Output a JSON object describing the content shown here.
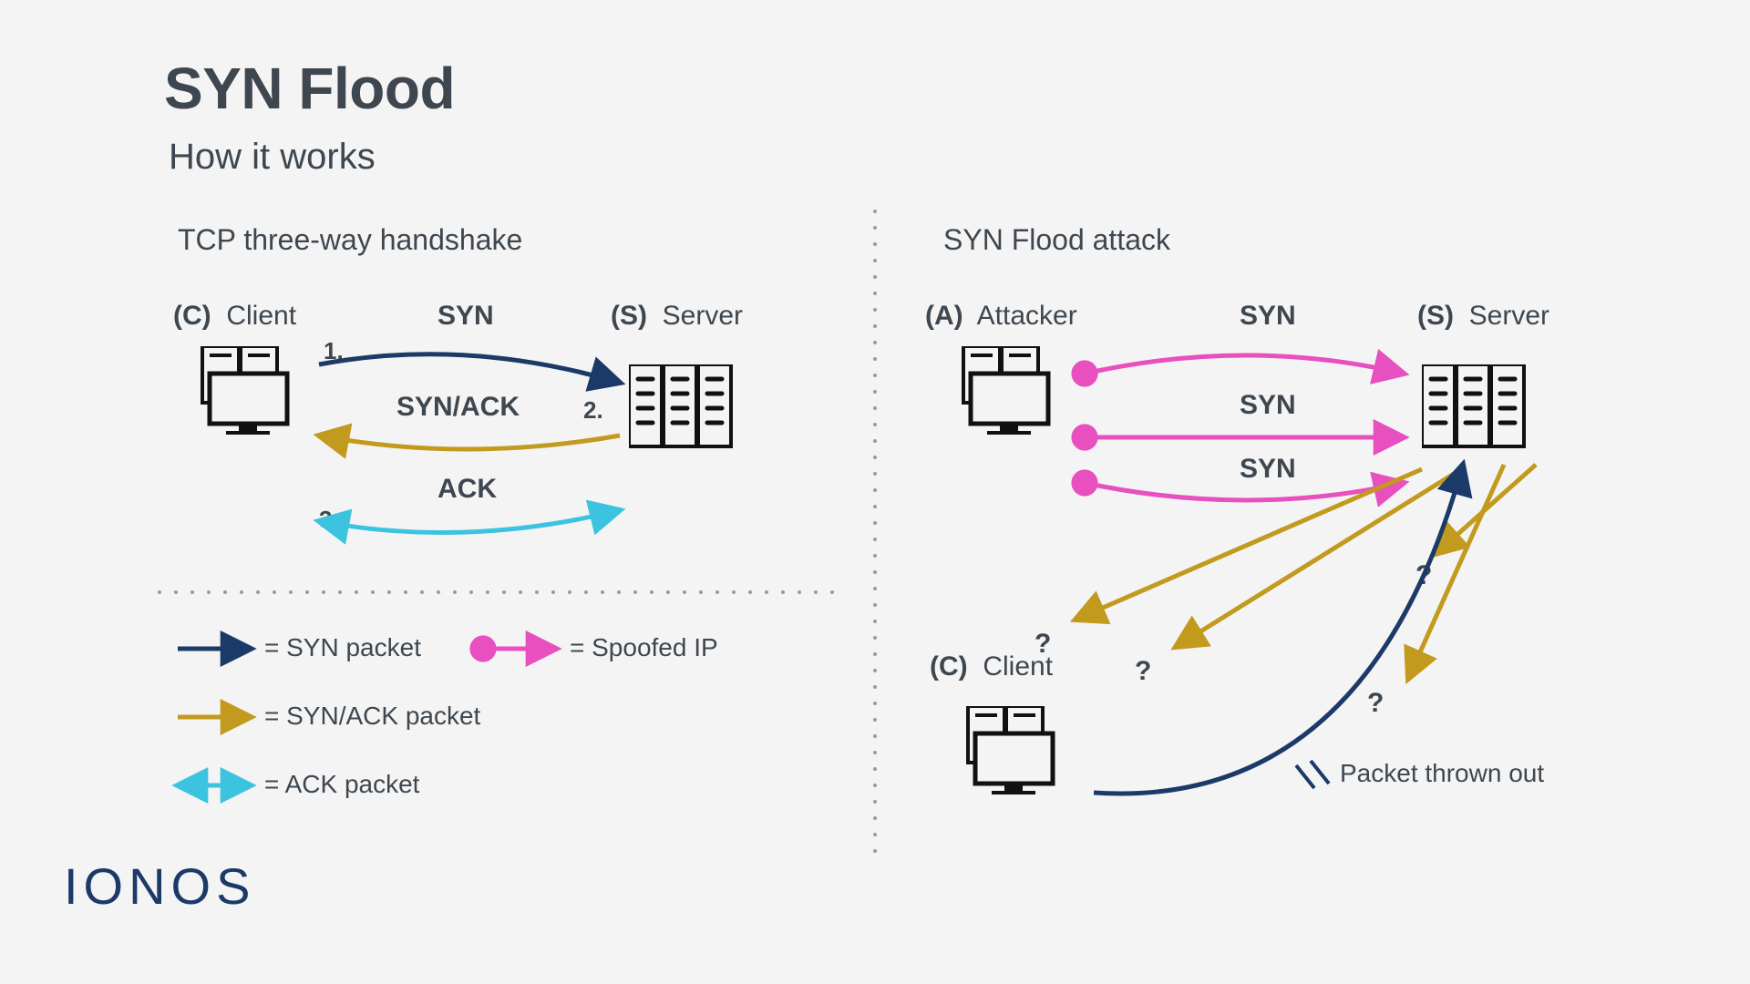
{
  "title": "SYN Flood",
  "subtitle": "How it works",
  "left": {
    "section": "TCP three-way handshake",
    "client_tag": "(C)",
    "client_label": "Client",
    "server_tag": "(S)",
    "server_label": "Server",
    "step1": "1.",
    "step2": "2.",
    "step3": "3.",
    "syn": "SYN",
    "synack": "SYN/ACK",
    "ack": "ACK"
  },
  "right": {
    "section": "SYN Flood attack",
    "attacker_tag": "(A)",
    "attacker_label": "Attacker",
    "server_tag": "(S)",
    "server_label": "Server",
    "client_tag": "(C)",
    "client_label": "Client",
    "syn1": "SYN",
    "syn2": "SYN",
    "syn3": "SYN",
    "q": "?",
    "thrown": "Packet thrown out"
  },
  "legend": {
    "syn": "= SYN packet",
    "spoofed": "= Spoofed IP",
    "synack": "= SYN/ACK packet",
    "ack": "= ACK packet"
  },
  "colors": {
    "syn": "#1b3a68",
    "synack": "#c19a1e",
    "ack": "#3cc3e0",
    "spoofed": "#e84fbf",
    "text": "#3e474f",
    "dotgrey": "#9a9a9a"
  },
  "logo": "IONOS"
}
